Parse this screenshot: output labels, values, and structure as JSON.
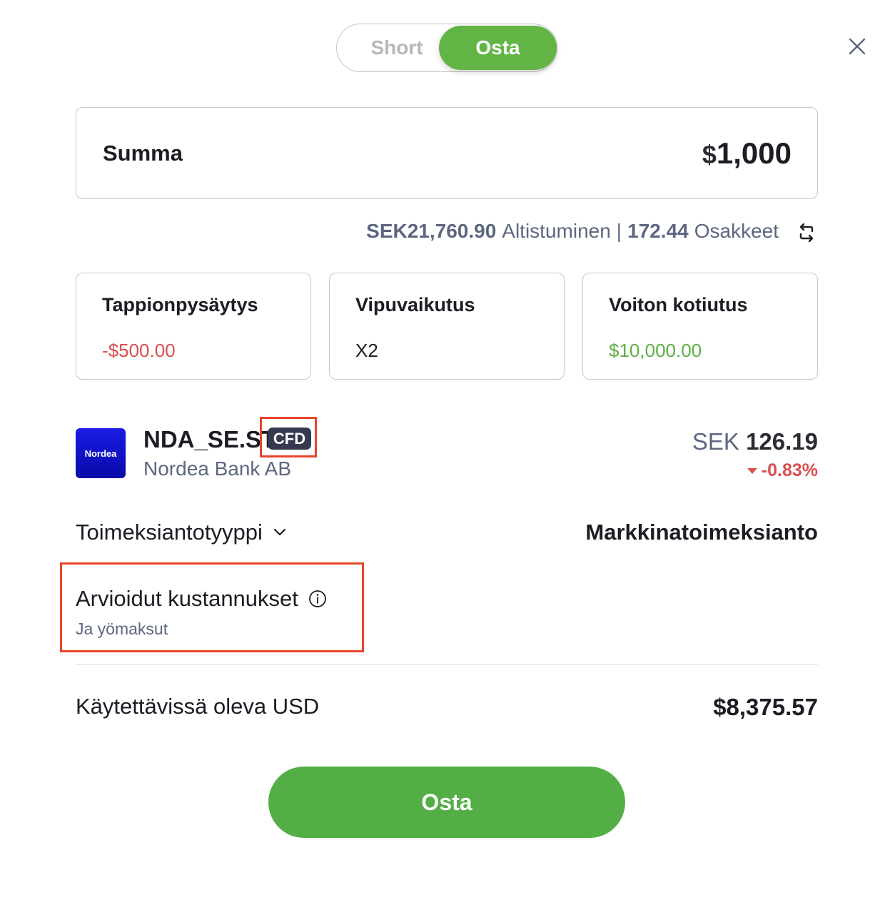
{
  "toggle": {
    "options": [
      {
        "label": "Short",
        "active": false
      },
      {
        "label": "Osta",
        "active": true
      }
    ]
  },
  "close": {
    "icon": "close-icon"
  },
  "amount": {
    "label": "Summa",
    "currency_symbol": "$",
    "value": "1,000"
  },
  "exposure": {
    "exposure_value": "SEK21,760.90",
    "exposure_label": "Altistuminen",
    "separator": "|",
    "units_value": "172.44",
    "units_label": "Osakkeet",
    "swap_icon": "swap-arrows-icon"
  },
  "cards": [
    {
      "label": "Tappionpysäytys",
      "value": "-$500.00",
      "tone": "negative"
    },
    {
      "label": "Vipuvaikutus",
      "value": "X2",
      "tone": "neutral"
    },
    {
      "label": "Voiton kotiutus",
      "value": "$10,000.00",
      "tone": "positive"
    }
  ],
  "instrument": {
    "logo_text": "Nordea",
    "symbol": "NDA_SE.ST",
    "badge": "CFD",
    "company": "Nordea Bank AB",
    "price_currency": "SEK",
    "price": "126.19",
    "change": "-0.83%",
    "change_direction": "down"
  },
  "order": {
    "type_label": "Toimeksiantotyyppi",
    "type_value": "Markkinatoimeksianto"
  },
  "costs": {
    "title": "Arvioidut kustannukset",
    "subtitle": "Ja yömaksut"
  },
  "available": {
    "label": "Käytettävissä oleva USD",
    "value": "$8,375.57"
  },
  "submit": {
    "label": "Osta"
  },
  "colors": {
    "accent_green": "#53ae46",
    "negative_red": "#d84f50",
    "positive_green": "#5cb043",
    "highlight_red": "#e8452c",
    "badge_dark": "#363a4f"
  }
}
